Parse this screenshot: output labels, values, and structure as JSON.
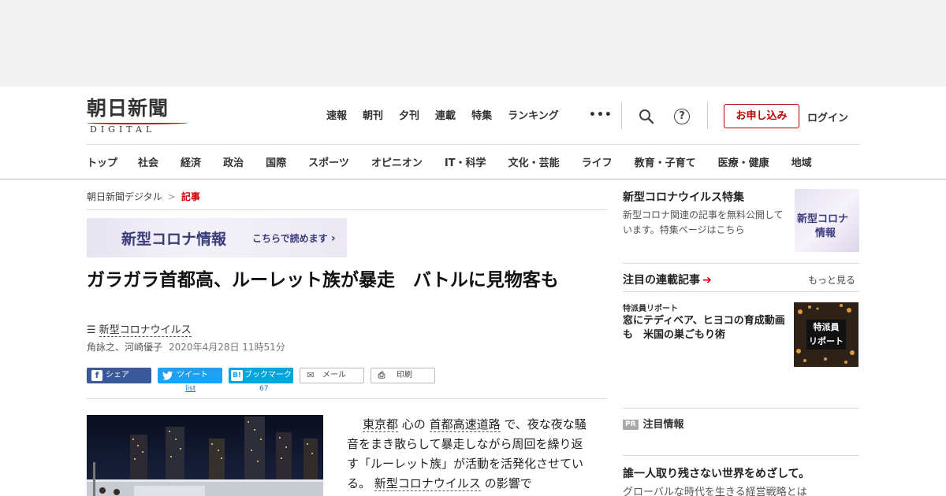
{
  "logo": {
    "kanji": "朝日新聞",
    "roman": "DIGITAL"
  },
  "global_nav": [
    "速報",
    "朝刊",
    "夕刊",
    "連載",
    "特集",
    "ランキング"
  ],
  "header": {
    "more": "•••",
    "help": "?",
    "apply_label": "お申し込み",
    "login_label": "ログイン"
  },
  "sub_nav": [
    "トップ",
    "社会",
    "経済",
    "政治",
    "国際",
    "スポーツ",
    "オピニオン",
    "IT・科学",
    "文化・芸能",
    "ライフ",
    "教育・子育て",
    "医療・健康",
    "地域"
  ],
  "breadcrumb": {
    "home": "朝日新聞デジタル",
    "sep": ">",
    "current": "記事"
  },
  "corona_banner": {
    "title": "新型コロナ情報",
    "cta": "こちらで読めます"
  },
  "article": {
    "headline": "ガラガラ首都高、ルーレット族が暴走　バトルに見物客も",
    "tag": "新型コロナウイルス",
    "authors": "角詠之、河崎優子",
    "date": "2020年4月28日 11時51分",
    "body": {
      "p1": "東京都",
      "p2": "心の",
      "p3": "首都高速道路",
      "p4": "で、夜な夜な騒音をまき散らして暴走しながら周回を繰り返す「ルーレット族」が活動を活発化させている。",
      "p5": "新型コロナウイルス",
      "p6": "の影響で"
    }
  },
  "share": {
    "facebook": "シェア",
    "twitter": "ツイート",
    "twitter_count": "list",
    "hatena_icon": "B!",
    "hatena": "ブックマーク",
    "hatena_count": "67",
    "mail": "メール",
    "print": "印刷"
  },
  "sidebar": {
    "feature_title": "新型コロナウイルス特集",
    "feature_desc": "新型コロナ関連の記事を無料公開しています。特集ページはこちら",
    "feature_thumb_1": "新型コロナ",
    "feature_thumb_2": "情報",
    "series_title": "注目の連載記事",
    "series_more": "もっと見る",
    "series_label": "特派員リポート",
    "series_article": "窓にテディベア、ヒヨコの育成動画も　米国の巣ごもり術",
    "series_thumb_1": "特派員",
    "series_thumb_2": "リポート",
    "pr_badge": "PR",
    "pr_title": "注目情報",
    "pr_item_title": "誰一人取り残さない世界をめざして。",
    "pr_item_desc": "グローバルな時代を生きる経営戦略とは"
  },
  "colors": {
    "accent": "#cc0000",
    "facebook": "#3b5998",
    "twitter": "#1da1f2",
    "hatena": "#00a4de",
    "corona": "#3a3c7a"
  }
}
